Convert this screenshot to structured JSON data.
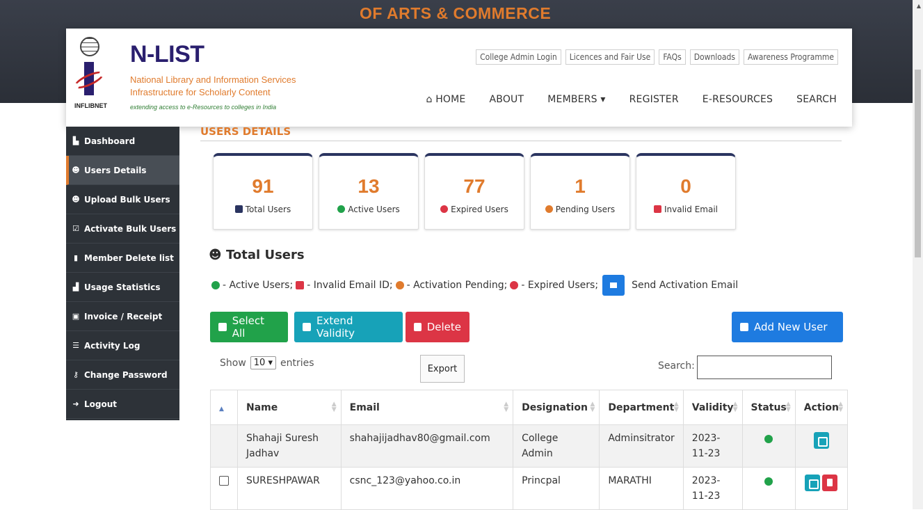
{
  "banner": {
    "title": "OF ARTS & COMMERCE"
  },
  "brand": {
    "name": "N-LIST",
    "line1": "National Library and Information Services",
    "line2": "Infrastructure for Scholarly Content",
    "tagline": "extending access to e-Resources to colleges in India",
    "logo_text": "INFLIBNET"
  },
  "top_links": [
    "College Admin Login",
    "Licences and Fair Use",
    "FAQs",
    "Downloads",
    "Awareness Programme"
  ],
  "main_nav": {
    "home": "HOME",
    "about": "ABOUT",
    "members": "MEMBERS ▾",
    "register": "REGISTER",
    "eresources": "E-RESOURCES",
    "search": "SEARCH"
  },
  "sidebar": {
    "items": [
      {
        "label": "Dashboard",
        "icon": "dashboard-icon"
      },
      {
        "label": "Users Details",
        "icon": "users-icon"
      },
      {
        "label": "Upload Bulk Users",
        "icon": "upload-users-icon"
      },
      {
        "label": "Activate Bulk Users",
        "icon": "check-square-icon"
      },
      {
        "label": "Member Delete list",
        "icon": "trash-icon"
      },
      {
        "label": "Usage Statistics",
        "icon": "bar-chart-icon"
      },
      {
        "label": "Invoice / Receipt",
        "icon": "printer-icon"
      },
      {
        "label": "Activity Log",
        "icon": "list-icon"
      },
      {
        "label": "Change Password",
        "icon": "key-icon"
      },
      {
        "label": "Logout",
        "icon": "logout-icon"
      }
    ],
    "active_index": 1
  },
  "page": {
    "title": "USERS DETAILS"
  },
  "stats": [
    {
      "value": "91",
      "label": "Total Users",
      "icon": "users-icon",
      "color": "#2a3460"
    },
    {
      "value": "13",
      "label": "Active Users",
      "icon": "check-circle-icon",
      "color": "#21a24a"
    },
    {
      "value": "77",
      "label": "Expired Users",
      "icon": "x-circle-icon",
      "color": "#dc3545"
    },
    {
      "value": "1",
      "label": "Pending Users",
      "icon": "pending-icon",
      "color": "#e07b2d"
    },
    {
      "value": "0",
      "label": "Invalid Email",
      "icon": "invalid-email-icon",
      "color": "#dc3545"
    }
  ],
  "section": {
    "title": "Total Users"
  },
  "legend": {
    "active": "- Active Users;",
    "invalid": "- Invalid Email ID;",
    "pending": "- Activation Pending;",
    "expired": "- Expired Users;",
    "send": "Send Activation Email"
  },
  "buttons": {
    "select_all": "Select All",
    "extend": "Extend Validity",
    "delete": "Delete",
    "add_user": "Add New User",
    "export": "Export"
  },
  "table_controls": {
    "show": "Show",
    "entries_value": "10",
    "entries": "entries",
    "search": "Search:"
  },
  "table": {
    "headers": [
      "",
      "Name",
      "Email",
      "Designation",
      "Department",
      "Validity",
      "Status",
      "Action"
    ],
    "rows": [
      {
        "name": "Shahaji Suresh Jadhav",
        "email": "shahajijadhav80@gmail.com",
        "designation": "College Admin",
        "department": "Adminsitrator",
        "validity": "2023-11-23",
        "status": "active"
      },
      {
        "name": "SURESHPAWAR",
        "email": "csnc_123@yahoo.co.in",
        "designation": "Princpal",
        "department": "MARATHI",
        "validity": "2023-11-23",
        "status": "active"
      }
    ]
  },
  "colors": {
    "accent": "#e07b2d",
    "sidebar": "#2d3238",
    "success": "#21a24a",
    "danger": "#dc3545",
    "info": "#17a2b8",
    "primary": "#1e7be0"
  }
}
